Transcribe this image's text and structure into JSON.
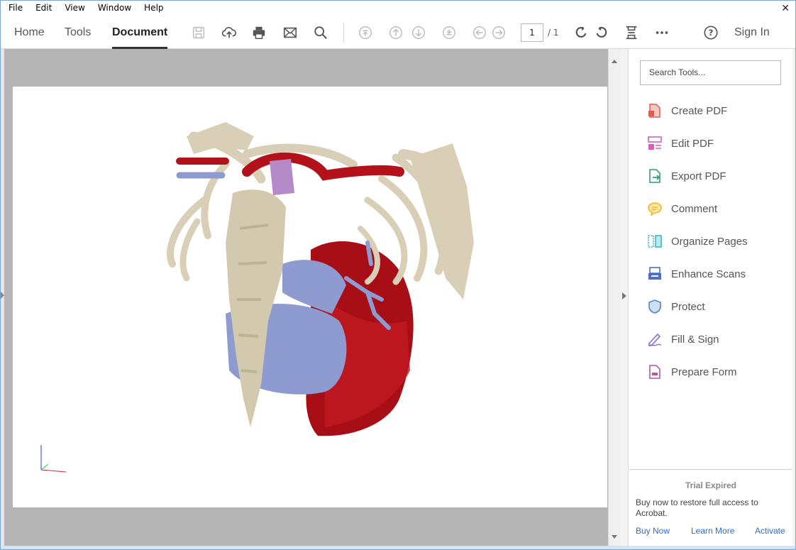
{
  "menu": {
    "items": [
      "File",
      "Edit",
      "View",
      "Window",
      "Help"
    ]
  },
  "toolbar": {
    "tabs": {
      "home": "Home",
      "tools": "Tools",
      "document": "Document"
    },
    "page_current": "1",
    "page_total": "/ 1",
    "sign_in": "Sign In",
    "icons": [
      "save-icon",
      "upload-icon",
      "print-icon",
      "email-icon",
      "search-icon",
      "first-page-icon",
      "prev-page-icon",
      "next-page-icon",
      "last-page-icon",
      "back-icon",
      "forward-icon",
      "rotate-cw-icon",
      "rotate-ccw-icon",
      "fit-page-icon",
      "more-icon",
      "help-icon"
    ]
  },
  "sidebar": {
    "search_placeholder": "Search Tools...",
    "tools": [
      {
        "label": "Create PDF",
        "color": "#e05a4f"
      },
      {
        "label": "Edit PDF",
        "color": "#d35fbf"
      },
      {
        "label": "Export PDF",
        "color": "#2e9d7a"
      },
      {
        "label": "Comment",
        "color": "#f2b824"
      },
      {
        "label": "Organize Pages",
        "color": "#34b6c9"
      },
      {
        "label": "Enhance Scans",
        "color": "#4a6fc8"
      },
      {
        "label": "Protect",
        "color": "#4d86d1"
      },
      {
        "label": "Fill & Sign",
        "color": "#8c6bd1"
      },
      {
        "label": "Prepare Form",
        "color": "#b05aa6"
      }
    ]
  },
  "trial": {
    "title": "Trial Expired",
    "message": "Buy now to restore full access to Acrobat.",
    "buy_now": "Buy Now",
    "learn_more": "Learn More",
    "activate": "Activate"
  },
  "colors": {
    "bone": "#d8cfb6",
    "artery": "#b3121a",
    "vein": "#8d9bd0",
    "airway": "#b48ac8"
  }
}
